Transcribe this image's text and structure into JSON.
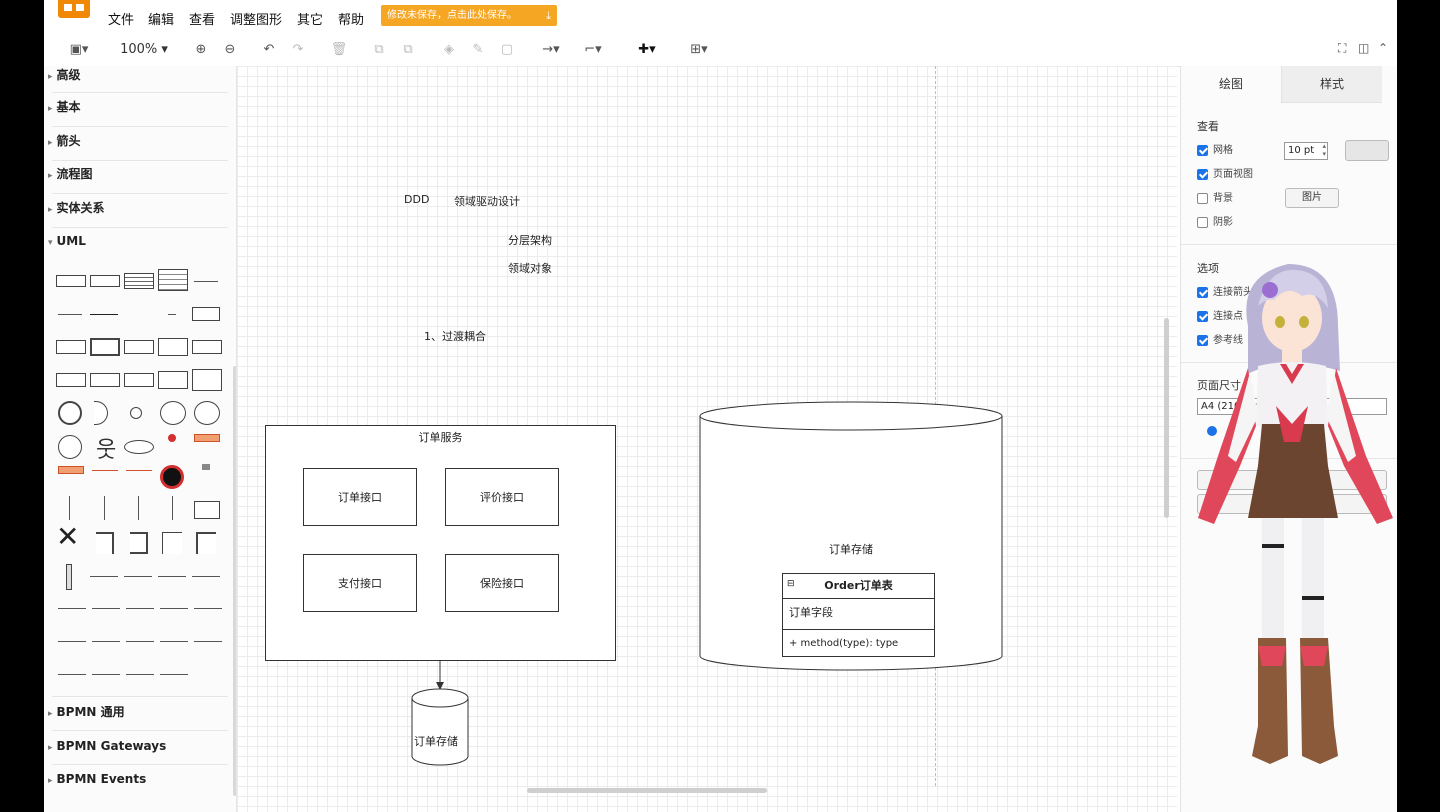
{
  "menubar": {
    "items": [
      "文件",
      "编辑",
      "查看",
      "调整图形",
      "其它",
      "帮助"
    ],
    "save_notice": "修改未保存，点击此处保存。"
  },
  "toolbar": {
    "zoom": "100%"
  },
  "sidebar": {
    "sections_top": [
      "高级",
      "基本",
      "箭头",
      "流程图",
      "实体关系",
      "UML"
    ],
    "sections_bottom": [
      "BPMN 通用",
      "BPMN Gateways",
      "BPMN Events"
    ]
  },
  "canvas": {
    "texts": {
      "ddd": "DDD",
      "domain_driven": "领域驱动设计",
      "layered": "分层架构",
      "domain_object": "领域对象",
      "coupling": "1、过渡耦合"
    },
    "order_service": {
      "title": "订单服务",
      "interfaces": [
        "订单接口",
        "评价接口",
        "支付接口",
        "保险接口"
      ]
    },
    "small_db_label": "订单存储",
    "big_db_label": "订单存储",
    "uml_class": {
      "name": "Order订单表",
      "field": "订单字段",
      "method": "+ method(type): type"
    }
  },
  "panel": {
    "tabs": [
      "绘图",
      "样式"
    ],
    "view_heading": "查看",
    "view_options": [
      {
        "label": "网格",
        "checked": true
      },
      {
        "label": "页面视图",
        "checked": true
      },
      {
        "label": "背景",
        "checked": false
      },
      {
        "label": "阴影",
        "checked": false
      }
    ],
    "grid_size": "10 pt",
    "image_button": "图片",
    "options_heading": "选项",
    "options": [
      {
        "label": "连接箭头",
        "checked": true
      },
      {
        "label": "连接点",
        "checked": true
      },
      {
        "label": "参考线",
        "checked": true
      }
    ],
    "page_size_heading": "页面尺寸",
    "page_size_value": "A4 (210 mm x 297 mm)"
  },
  "colors": {
    "brand": "#f08705",
    "save_banner": "#f5a623",
    "checkbox": "#1a73e8",
    "grid": "#ececec"
  }
}
